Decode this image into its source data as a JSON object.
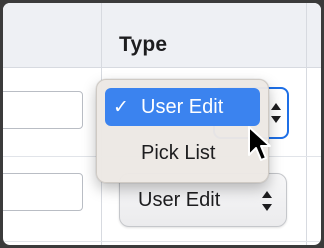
{
  "table": {
    "columns": [
      {
        "header": ""
      },
      {
        "header": "Type"
      }
    ],
    "rows": [
      {
        "type_value": "User Edit"
      },
      {
        "type_value": "User Edit"
      }
    ]
  },
  "popup_menu": {
    "items": [
      {
        "label": "User Edit",
        "checked": true,
        "check_glyph": "✓"
      },
      {
        "label": "Pick List",
        "checked": false
      }
    ]
  },
  "colors": {
    "header_bg": "#eef0f4",
    "selection_accent": "#3b83ef",
    "focus_ring": "#1e6fe6"
  },
  "icons": {
    "select_indicator": "up-down-chevron-icon",
    "cursor": "arrow-cursor-icon"
  }
}
